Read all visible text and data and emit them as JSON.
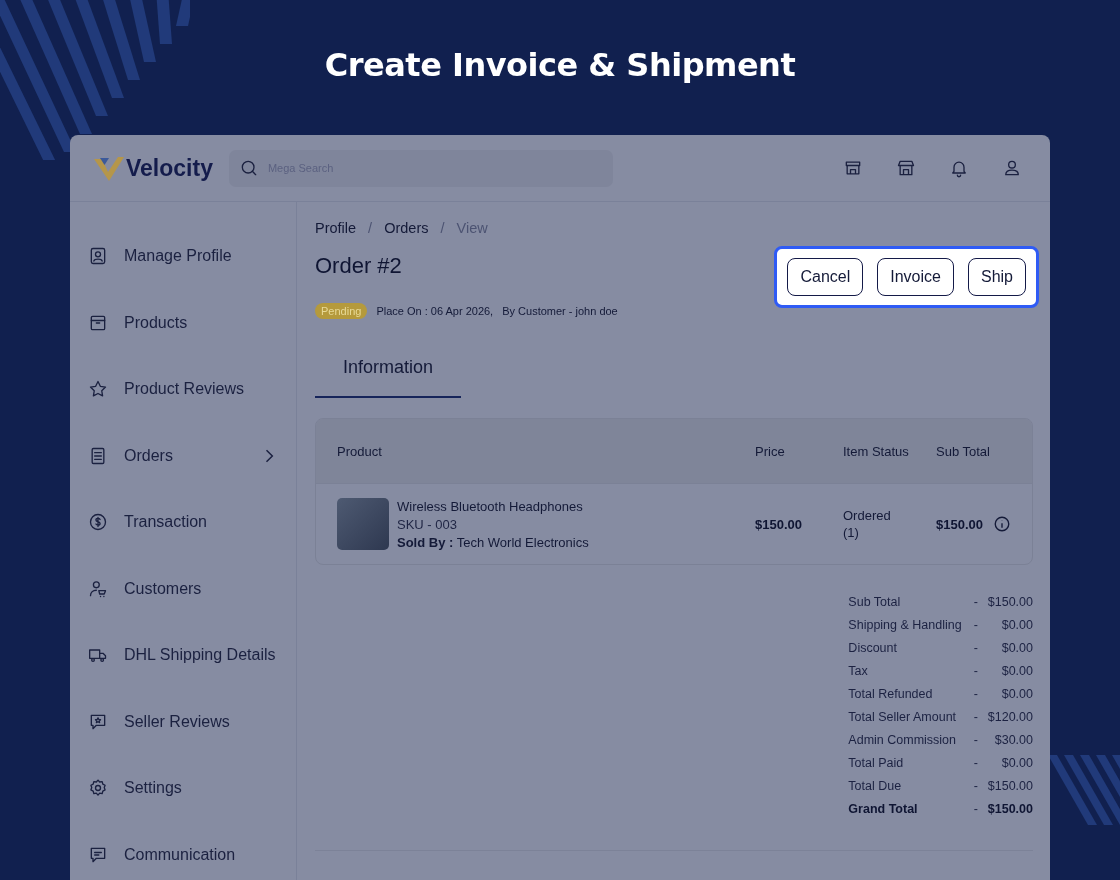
{
  "title": "Create Invoice & Shipment",
  "app": {
    "logo": "Velocity",
    "search": {
      "placeholder": "Mega Search"
    },
    "sidebar": {
      "items": [
        {
          "label": "Manage Profile",
          "expandable": false
        },
        {
          "label": "Products",
          "expandable": false
        },
        {
          "label": "Product Reviews",
          "expandable": false
        },
        {
          "label": "Orders",
          "expandable": true
        },
        {
          "label": "Transaction",
          "expandable": false
        },
        {
          "label": "Customers",
          "expandable": false
        },
        {
          "label": "DHL Shipping Details",
          "expandable": false
        },
        {
          "label": "Seller Reviews",
          "expandable": false
        },
        {
          "label": "Settings",
          "expandable": false
        },
        {
          "label": "Communication",
          "expandable": false
        }
      ]
    },
    "breadcrumb": [
      {
        "label": "Profile",
        "current": false,
        "separator": "/"
      },
      {
        "label": "Orders",
        "current": false,
        "separator": "/"
      },
      {
        "label": "View",
        "current": true
      }
    ],
    "order": {
      "title": "Order #2",
      "status": "Pending",
      "placed_on": "Place On : 06 Apr 2026,",
      "by": "By Customer - john doe"
    },
    "actions": {
      "highlighted": true,
      "buttons": [
        "Cancel",
        "Invoice",
        "Ship"
      ]
    },
    "tabs": [
      {
        "label": "Information",
        "selected": true
      }
    ],
    "table": {
      "columns": [
        "Product",
        "Price",
        "Item Status",
        "Sub Total"
      ],
      "rows": [
        {
          "name": "Wireless Bluetooth Headphones",
          "sku": "SKU - 003",
          "sold_by": "**Sold By :** Tech World Electronics",
          "price": "$150.00",
          "status": "Ordered (1)",
          "subtotal": "$150.00"
        }
      ]
    },
    "totals": [
      {
        "label": "Sub Total",
        "dash": "-",
        "value": "$150.00",
        "bold": false
      },
      {
        "label": "Shipping & Handling",
        "dash": "-",
        "value": "$0.00",
        "bold": false
      },
      {
        "label": "Discount",
        "dash": "-",
        "value": "$0.00",
        "bold": false
      },
      {
        "label": "Tax",
        "dash": "-",
        "value": "$0.00",
        "bold": false
      },
      {
        "label": "Total Refunded",
        "dash": "-",
        "value": "$0.00",
        "bold": false
      },
      {
        "label": "Total Seller Amount",
        "dash": "-",
        "value": "$120.00",
        "bold": false
      },
      {
        "label": "Admin Commission",
        "dash": "-",
        "value": "$30.00",
        "bold": false
      },
      {
        "label": "Total Paid",
        "dash": "-",
        "value": "$0.00",
        "bold": false
      },
      {
        "label": "Total Due",
        "dash": "-",
        "value": "$150.00",
        "bold": false
      },
      {
        "label": "Grand Total",
        "dash": "-",
        "value": "$150.00",
        "bold": true
      }
    ]
  }
}
